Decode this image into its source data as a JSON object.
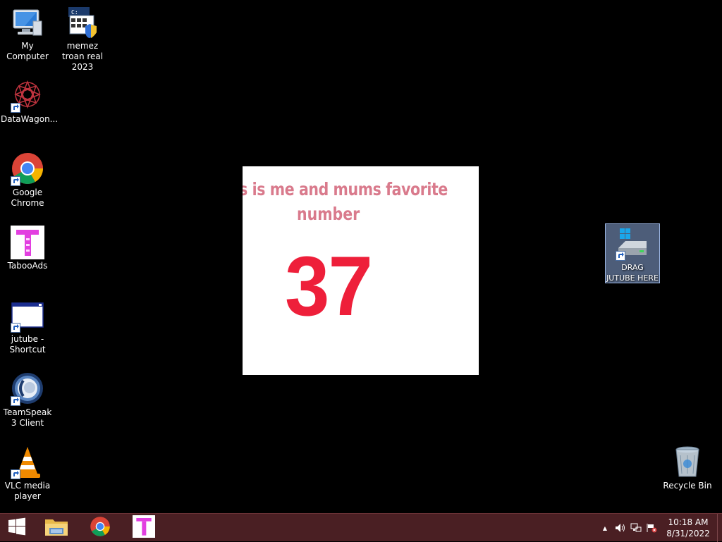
{
  "desktop": {
    "icons": [
      {
        "label": "My Computer",
        "icon": "computer-icon",
        "shortcut": false
      },
      {
        "label": "memez troan real 2023",
        "icon": "program-window-shield-icon",
        "shortcut": false
      },
      {
        "label": "DataWagon...",
        "icon": "red-spiral-icon",
        "shortcut": true
      },
      {
        "label": "Google Chrome",
        "icon": "chrome-icon",
        "shortcut": true
      },
      {
        "label": "TabooAds",
        "icon": "taboo-t-icon",
        "shortcut": false
      },
      {
        "label": "jutube - Shortcut",
        "icon": "window-icon",
        "shortcut": true
      },
      {
        "label": "TeamSpeak 3 Client",
        "icon": "teamspeak-icon",
        "shortcut": true
      },
      {
        "label": "VLC media player",
        "icon": "vlc-cone-icon",
        "shortcut": true
      },
      {
        "label": "DRAG JUTUBE HERE",
        "icon": "drive-windows-icon",
        "shortcut": true,
        "selected": true
      },
      {
        "label": "Recycle Bin",
        "icon": "recycle-bin-icon",
        "shortcut": false
      }
    ]
  },
  "popup": {
    "line1": "is is me and mums favorite",
    "line2": "number",
    "number": "37",
    "colors": {
      "text": "#d97a8c",
      "number": "#ee1f3a",
      "background": "#ffffff"
    }
  },
  "taskbar": {
    "color": "#4a1f23",
    "pinned": [
      {
        "name": "start-button",
        "icon": "windows-logo-icon"
      },
      {
        "name": "file-explorer-button",
        "icon": "folder-icon"
      },
      {
        "name": "chrome-taskbar-button",
        "icon": "chrome-icon"
      },
      {
        "name": "tabooads-taskbar-button",
        "icon": "taboo-t-icon"
      }
    ],
    "tray": {
      "chevron": "▲",
      "time": "10:18 AM",
      "date": "8/31/2022"
    }
  }
}
